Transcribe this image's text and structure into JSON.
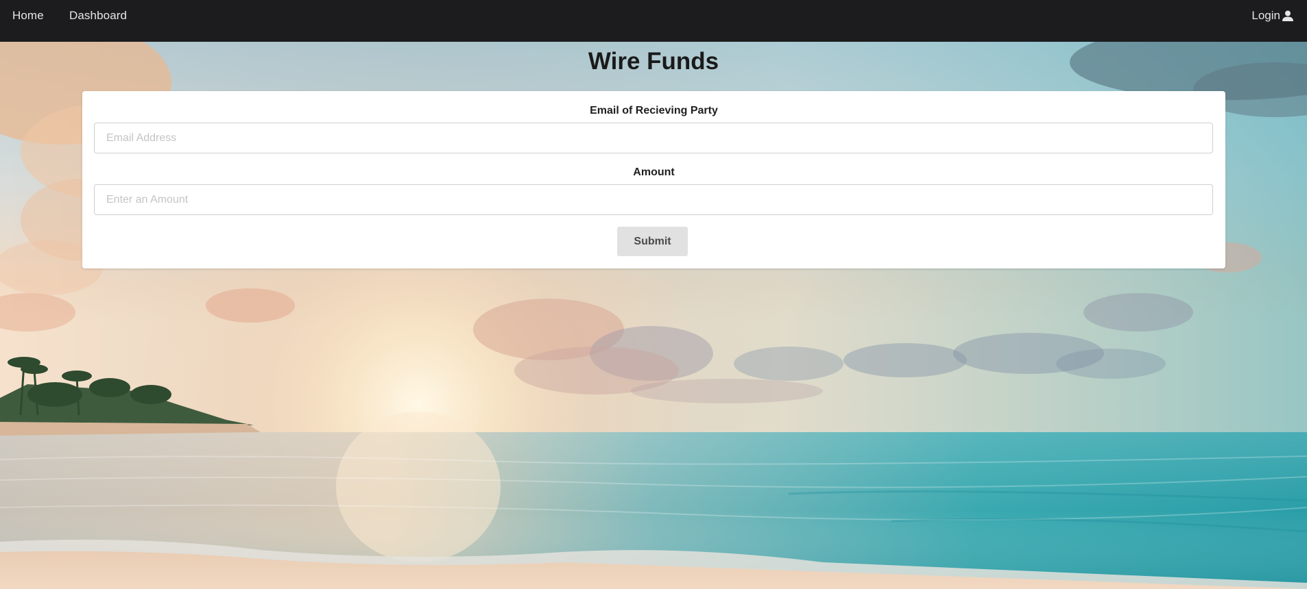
{
  "nav": {
    "home": "Home",
    "dashboard": "Dashboard",
    "login": "Login",
    "login_icon": "user-icon"
  },
  "page": {
    "title": "Wire Funds"
  },
  "form": {
    "email_label": "Email of Recieving Party",
    "email_placeholder": "Email Address",
    "email_value": "",
    "amount_label": "Amount",
    "amount_placeholder": "Enter an Amount",
    "amount_value": "",
    "submit_label": "Submit"
  },
  "colors": {
    "navbar": "#1c1c1e",
    "card": "#ffffff",
    "button": "#e1e1e1"
  }
}
